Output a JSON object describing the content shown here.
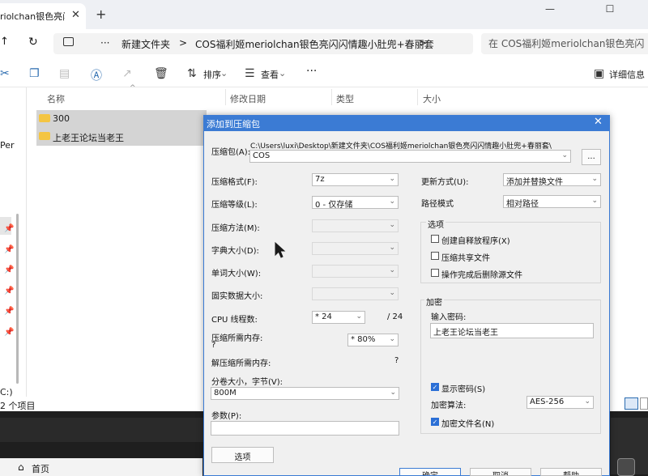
{
  "explorer": {
    "tab_title": "riolchan银色亮闪",
    "tab_close": "✕",
    "new_tab": "+",
    "window_buttons": [
      "—",
      "☐",
      "✕"
    ],
    "nav_up": "↑",
    "refresh": "↻",
    "more": "···",
    "breadcrumbs": [
      "新建文件夹",
      ">",
      "COS福利姬meriolchan银色亮闪闪情趣小肚兜+春丽套",
      ">"
    ],
    "search_placeholder": "在 COS福利姬meriolchan银色亮闪",
    "toolbar": {
      "sort": "排序",
      "view": "查看",
      "more": "···",
      "details": "详细信息"
    },
    "columns": [
      "名称",
      "修改日期",
      "类型",
      "大小"
    ],
    "files": [
      {
        "name": "300"
      },
      {
        "name": "上老王论坛当老王"
      }
    ],
    "left_nav_text": "Per",
    "status_count": "2 个项目",
    "status_drive": "C:)",
    "home": "首页"
  },
  "dialog": {
    "title": "添加到压缩包",
    "close": "✕",
    "archive_label": "压缩包(A):",
    "archive_path": "C:\\Users\\luxi\\Desktop\\新建文件夹\\COS福利姬meriolchan银色亮闪闪情趣小肚兜+春丽套\\",
    "archive_name": "COS",
    "browse": "...",
    "left": {
      "format": {
        "label": "压缩格式(F):",
        "value": "7z"
      },
      "level": {
        "label": "压缩等级(L):",
        "value": "0 - 仅存储"
      },
      "method": {
        "label": "压缩方法(M):",
        "value": ""
      },
      "dict": {
        "label": "字典大小(D):",
        "value": ""
      },
      "word": {
        "label": "单词大小(W):",
        "value": ""
      },
      "solid": {
        "label": "固实数据大小:",
        "value": ""
      },
      "threads": {
        "label": "CPU 线程数:",
        "value": "* 24",
        "max": "/ 24"
      },
      "mem_comp": {
        "label": "压缩所需内存:",
        "sub": "?",
        "value": "* 80%"
      },
      "mem_decomp": {
        "label": "解压缩所需内存:",
        "value": "?"
      },
      "volume": {
        "label": "分卷大小，字节(V):",
        "value": "800M"
      },
      "params": {
        "label": "参数(P):",
        "value": ""
      },
      "options_button": "选项"
    },
    "right": {
      "update": {
        "label": "更新方式(U):",
        "value": "添加并替换文件"
      },
      "path": {
        "label": "路径模式",
        "value": "相对路径"
      },
      "options_title": "选项",
      "options": [
        {
          "label": "创建自释放程序(X)",
          "checked": false
        },
        {
          "label": "压缩共享文件",
          "checked": false
        },
        {
          "label": "操作完成后删除源文件",
          "checked": false
        }
      ],
      "encrypt_title": "加密",
      "password_label": "输入密码:",
      "password_value": "上老王论坛当老王",
      "show_password": {
        "label": "显示密码(S)",
        "checked": true
      },
      "enc_method": {
        "label": "加密算法:",
        "value": "AES-256"
      },
      "encrypt_names": {
        "label": "加密文件名(N)",
        "checked": true
      }
    },
    "buttons": [
      "确定",
      "取消",
      "帮助"
    ]
  }
}
